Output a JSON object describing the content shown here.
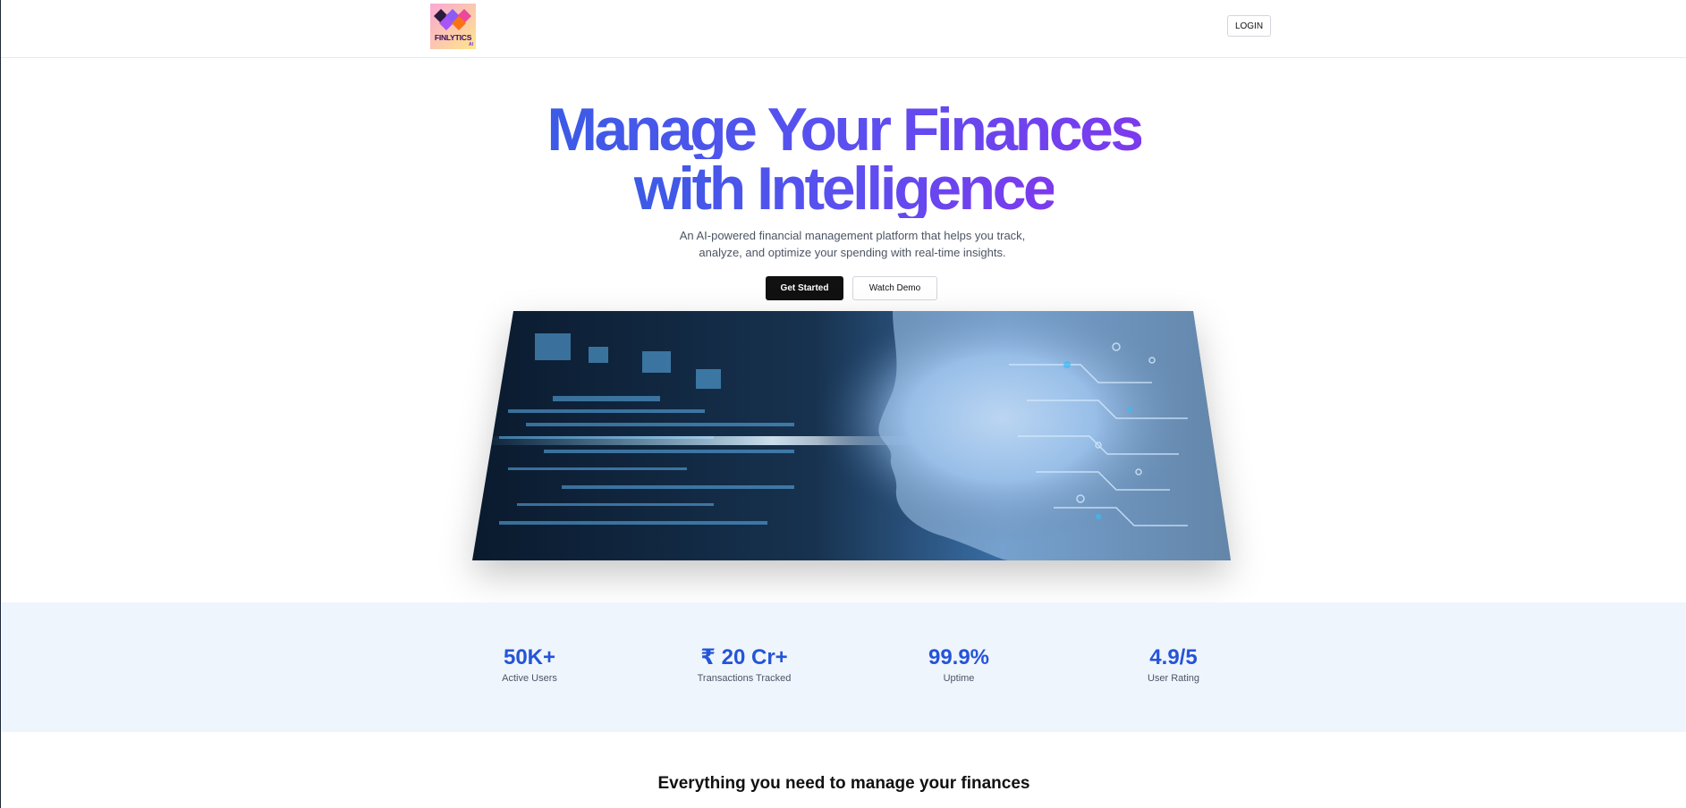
{
  "brand": {
    "name": "FINLYTICS",
    "suffix": "AI"
  },
  "nav": {
    "login_label": "LOGIN"
  },
  "hero": {
    "title_line1": "Manage Your Finances",
    "title_line2": "with Intelligence",
    "subtitle_line1": "An AI-powered financial management platform that helps you track,",
    "subtitle_line2": "analyze, and optimize your spending with real-time insights.",
    "primary_cta": "Get Started",
    "secondary_cta": "Watch Demo"
  },
  "stats": [
    {
      "value": "50K+",
      "label": "Active Users"
    },
    {
      "value": "₹ 20 Cr+",
      "label": "Transactions Tracked"
    },
    {
      "value": "99.9%",
      "label": "Uptime"
    },
    {
      "value": "4.9/5",
      "label": "User Rating"
    }
  ],
  "features": {
    "title": "Everything you need to manage your finances"
  },
  "colors": {
    "accent": "#2554d8",
    "gradient_start": "#3b5be6",
    "gradient_end": "#7c3aed",
    "stats_bg": "#eff5fd"
  }
}
